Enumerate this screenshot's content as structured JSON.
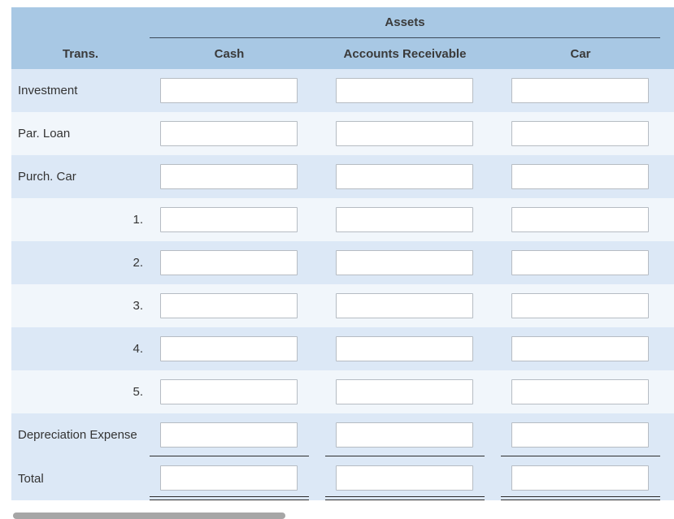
{
  "header": {
    "group_title": "Assets",
    "columns": [
      "Trans.",
      "Cash",
      "Accounts Receivable",
      "Car"
    ]
  },
  "rows": [
    {
      "label": "Investment",
      "align": "left"
    },
    {
      "label": "Par. Loan",
      "align": "left"
    },
    {
      "label": "Purch. Car",
      "align": "left"
    },
    {
      "label": "1.",
      "align": "right"
    },
    {
      "label": "2.",
      "align": "right"
    },
    {
      "label": "3.",
      "align": "right"
    },
    {
      "label": "4.",
      "align": "right"
    },
    {
      "label": "5.",
      "align": "right"
    },
    {
      "label": "Depreciation Expense",
      "align": "left"
    }
  ],
  "total": {
    "label": "Total"
  },
  "colors": {
    "header_bg": "#a8c8e4",
    "row_alt_1": "#dce8f6",
    "row_alt_2": "#f1f6fb"
  }
}
